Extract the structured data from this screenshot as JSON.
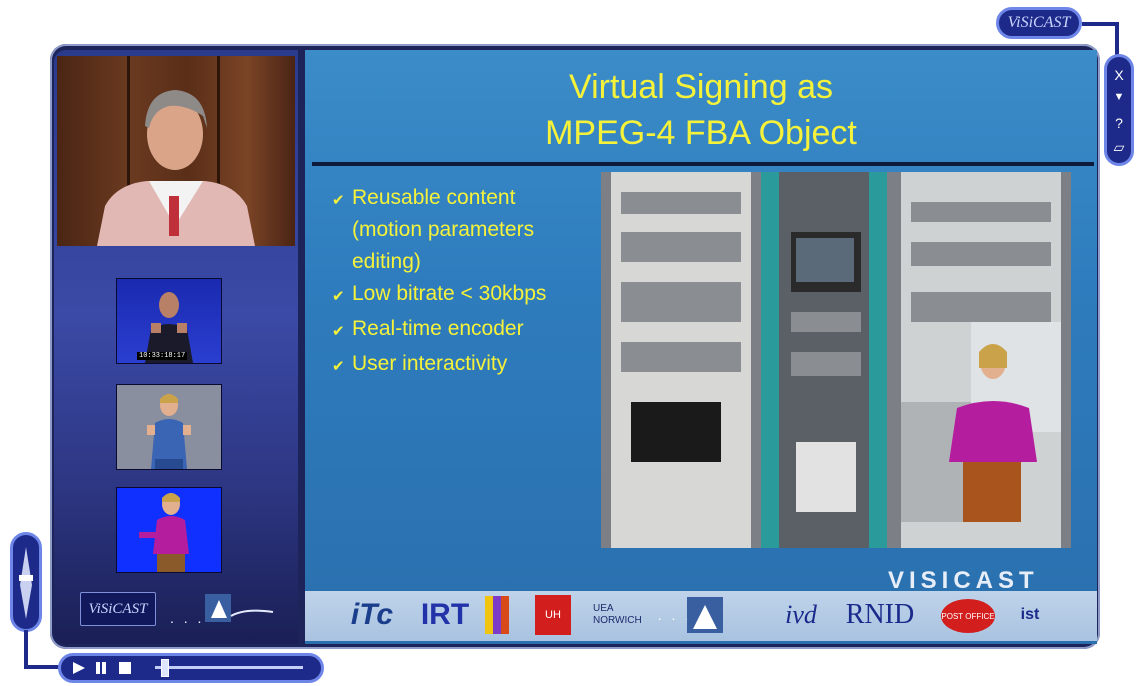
{
  "app": {
    "brand_logo": "ViSiCAST"
  },
  "window_controls": {
    "close_label": "X",
    "minimize_label": "▼",
    "help_label": "?",
    "open_label": "▱"
  },
  "slide": {
    "title_line1": "Virtual Signing as",
    "title_line2": "MPEG-4 FBA Object",
    "bullets": [
      {
        "text": "Reusable content\n(motion parameters\nediting)"
      },
      {
        "text": "Low bitrate < 30kbps"
      },
      {
        "text": "Real-time encoder"
      },
      {
        "text": "User interactivity"
      }
    ],
    "project_name": "VISICAST",
    "partners": [
      "iTc",
      "IRT",
      "UEA NORWICH",
      "RNID",
      "POST OFFICE",
      "ist",
      "UH"
    ]
  },
  "left_panel": {
    "thumbnail_timecode": "10:33:18:17"
  },
  "colors": {
    "frame": "#1c2459",
    "slide_bg": "#2e7cbd",
    "title_text": "#f6f23a",
    "control_border": "#6e86e8"
  }
}
